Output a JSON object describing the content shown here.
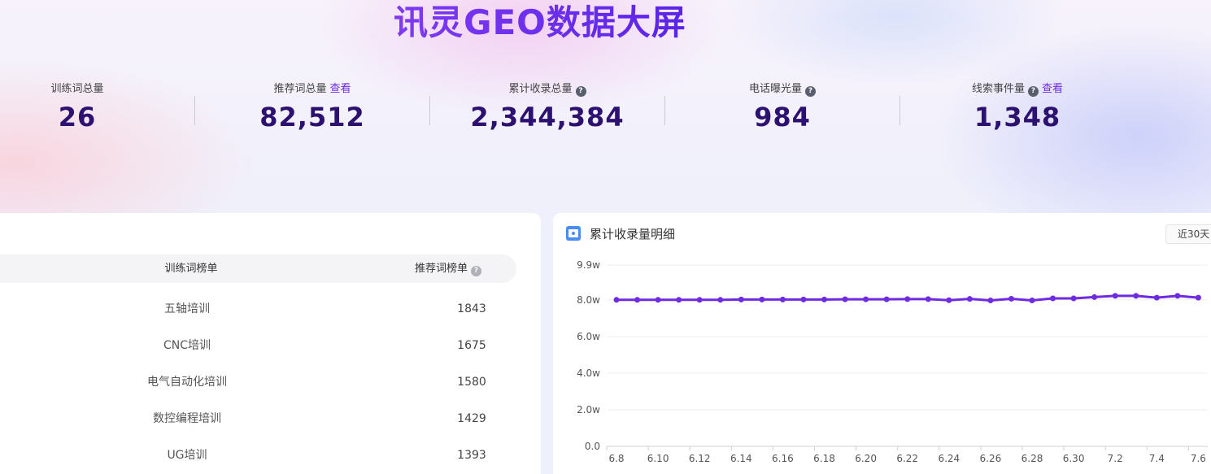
{
  "header": {
    "title": "讯灵GEO数据大屏"
  },
  "stats": [
    {
      "label": "训练词总量",
      "value": "26",
      "link": "",
      "help": false
    },
    {
      "label": "推荐词总量",
      "value": "82,512",
      "link": "查看",
      "help": false
    },
    {
      "label": "累计收录总量",
      "value": "2,344,384",
      "link": "",
      "help": true
    },
    {
      "label": "电话曝光量",
      "value": "984",
      "link": "",
      "help": true
    },
    {
      "label": "线索事件量",
      "value": "1,348",
      "link": "查看",
      "help": true
    }
  ],
  "help_icon": "question-icon",
  "ranking": {
    "col_train": "训练词榜单",
    "col_recommend": "推荐词榜单",
    "rows": [
      {
        "name": "五轴培训",
        "value": "1843"
      },
      {
        "name": "CNC培训",
        "value": "1675"
      },
      {
        "name": "电气自动化培训",
        "value": "1580"
      },
      {
        "name": "数控编程培训",
        "value": "1429"
      },
      {
        "name": "UG培训",
        "value": "1393"
      }
    ]
  },
  "chart_panel": {
    "title": "累计收录量明细",
    "icon": "calendar-chart-icon",
    "range": "近30天"
  },
  "chart_data": {
    "type": "line",
    "title": "累计收录量明细",
    "y_tick_labels": [
      "0.0",
      "2.0w",
      "4.0w",
      "6.0w",
      "8.0w",
      "9.9w"
    ],
    "y_ticks": [
      0,
      2.0,
      4.0,
      6.0,
      8.0,
      9.9
    ],
    "ylim": [
      0,
      9.9
    ],
    "y_unit": "w",
    "x_tick_labels": [
      "6.8",
      "6.10",
      "6.12",
      "6.14",
      "6.16",
      "6.18",
      "6.20",
      "6.22",
      "6.24",
      "6.26",
      "6.28",
      "6.30",
      "7.2",
      "7.4",
      "7.6"
    ],
    "x": [
      "6.8",
      "6.9",
      "6.10",
      "6.11",
      "6.12",
      "6.13",
      "6.14",
      "6.15",
      "6.16",
      "6.17",
      "6.18",
      "6.19",
      "6.20",
      "6.21",
      "6.22",
      "6.23",
      "6.24",
      "6.25",
      "6.26",
      "6.27",
      "6.28",
      "6.29",
      "6.30",
      "7.1",
      "7.2",
      "7.3",
      "7.4",
      "7.5",
      "7.6"
    ],
    "series": [
      {
        "values": [
          8.0,
          8.0,
          8.0,
          8.0,
          8.0,
          8.0,
          8.02,
          8.02,
          8.02,
          8.02,
          8.02,
          8.03,
          8.03,
          8.03,
          8.04,
          8.04,
          7.98,
          8.05,
          7.97,
          8.06,
          7.97,
          8.08,
          8.08,
          8.15,
          8.22,
          8.22,
          8.12,
          8.22,
          8.12
        ],
        "color": "#6f2be0"
      }
    ],
    "grid": true
  }
}
